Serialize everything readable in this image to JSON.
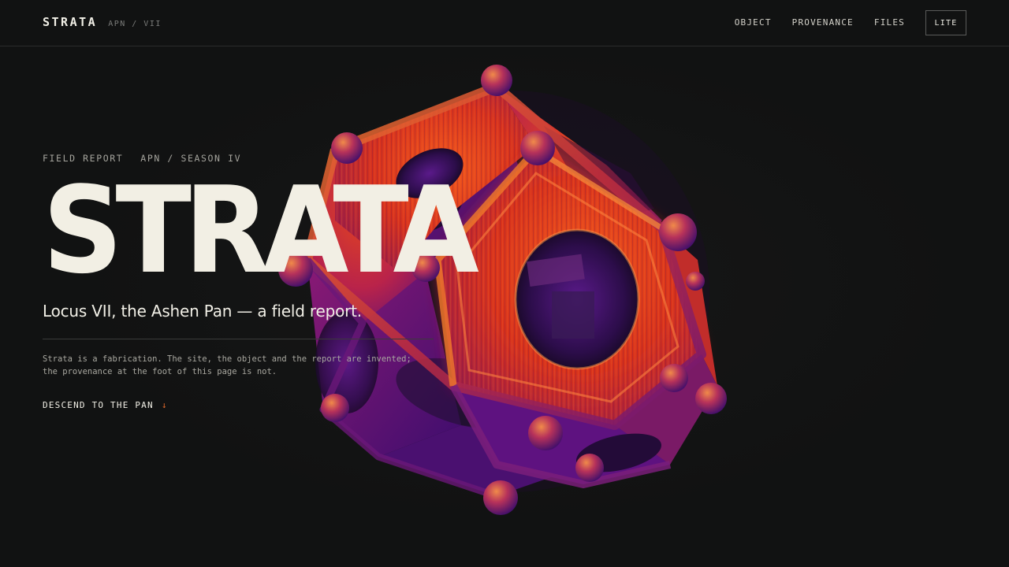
{
  "header": {
    "brand": "STRATA",
    "brand_sub": "APN / VII",
    "nav": [
      "OBJECT",
      "PROVENANCE",
      "FILES"
    ],
    "lite_label": "LITE"
  },
  "hero": {
    "kicker_left": "FIELD REPORT",
    "kicker_right": "APN / SEASON IV",
    "title": "STRATA",
    "subtitle": "Locus VII, the Ashen Pan — a field report.",
    "disclaimer_line1": "Strata is a fabrication. The site, the object and the report are invented;",
    "disclaimer_line2": "the provenance at the foot of this page is not.",
    "cta": "DESCEND TO THE PAN",
    "cta_arrow": "↓"
  },
  "colors": {
    "background": "#111212",
    "text": "#f2efe4",
    "accent": "#e2692a",
    "artifact_hot": "#f25a1a",
    "artifact_cool": "#4a1178"
  },
  "icons": {
    "artifact": "dodecahedron-artifact",
    "cta": "arrow-down-icon"
  }
}
